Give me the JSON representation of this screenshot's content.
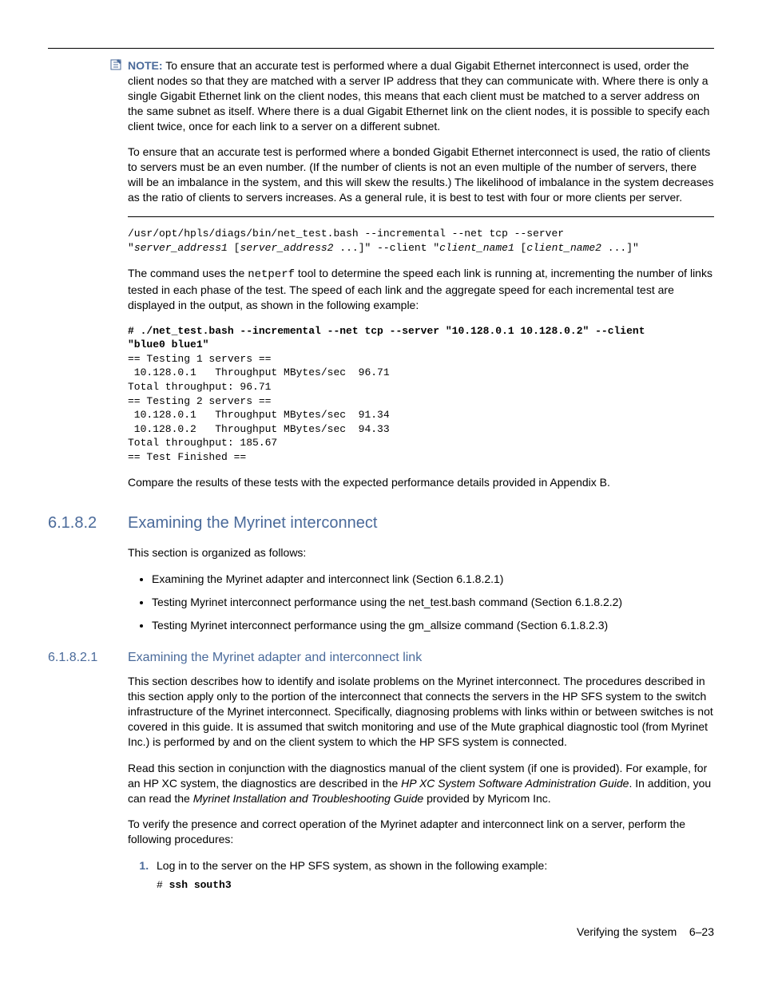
{
  "note": {
    "label": "NOTE:",
    "p1": "To ensure that an accurate test is performed where a dual Gigabit Ethernet interconnect is used, order the client nodes so that they are matched with a server IP address that they can communicate with. Where there is only a single Gigabit Ethernet link on the client nodes, this means that each client must be matched to a server address on the same subnet as itself. Where there is a dual Gigabit Ethernet link on the client nodes, it is possible to specify each client twice, once for each link to a server on a different subnet.",
    "p2": "To ensure that an accurate test is performed where a bonded Gigabit Ethernet interconnect is used, the ratio of clients to servers must be an even number. (If the number of clients is not an even multiple of the number of servers, there will be an imbalance in the system, and this will skew the results.) The likelihood of imbalance in the system decreases as the ratio of clients to servers increases. As a general rule, it is best to test with four or more clients per server."
  },
  "code1": {
    "line1a": "/usr/opt/hpls/diags/bin/net_test.bash --incremental --net tcp --server ",
    "line1b": "\"",
    "sv1": "server_address1",
    "br1": " [",
    "sv2": "server_address2",
    "el1": " ...]",
    "line2a": "\" --client \"",
    "cl1": "client_name1",
    "br2": " [",
    "cl2": "client_name2",
    "el2": " ...]",
    "end": "\""
  },
  "para_cmd_a": "The command uses the ",
  "para_cmd_tool": "netperf",
  "para_cmd_b": " tool to determine the speed each link is running at, incrementing the number of links tested in each phase of the test. The speed of each link and the aggregate speed for each incremental test are displayed in the output, as shown in the following example:",
  "code2": {
    "hdr1": "# ./net_test.bash --incremental --net tcp --server \"10.128.0.1 10.128.0.2\" --client ",
    "hdr2": "\"blue0 blue1\"",
    "body": "\n== Testing 1 servers ==\n 10.128.0.1   Throughput MBytes/sec  96.71\nTotal throughput: 96.71\n== Testing 2 servers ==\n 10.128.0.1   Throughput MBytes/sec  91.34\n 10.128.0.2   Throughput MBytes/sec  94.33\nTotal throughput: 185.67\n== Test Finished =="
  },
  "para_compare": "Compare the results of these tests with the expected performance details provided in Appendix B.",
  "s6182": {
    "num": "6.1.8.2",
    "title": "Examining the Myrinet interconnect",
    "intro": "This section is organized as follows:",
    "bullets": [
      "Examining the Myrinet adapter and interconnect link (Section 6.1.8.2.1)",
      "Testing Myrinet interconnect performance using the net_test.bash command (Section 6.1.8.2.2)",
      "Testing Myrinet interconnect performance using the gm_allsize command (Section 6.1.8.2.3)"
    ]
  },
  "s61821": {
    "num": "6.1.8.2.1",
    "title": "Examining the Myrinet adapter and interconnect link",
    "p1": "This section describes how to identify and isolate problems on the Myrinet interconnect. The procedures described in this section apply only to the portion of the interconnect that connects the servers in the HP SFS system to the switch infrastructure of the Myrinet interconnect. Specifically, diagnosing problems with links within or between switches is not covered in this guide. It is assumed that switch monitoring and use of the Mute graphical diagnostic tool (from Myrinet Inc.) is performed by and on the client system to which the HP SFS system is connected.",
    "p2a": "Read this section in conjunction with the diagnostics manual of the client system (if one is provided). For example, for an HP XC system, the diagnostics are described in the ",
    "p2i1": "HP XC System Software Administration Guide",
    "p2b": ". In addition, you can read the ",
    "p2i2": "Myrinet Installation and Troubleshooting Guide",
    "p2c": " provided by Myricom Inc.",
    "p3": "To verify the presence and correct operation of the Myrinet adapter and interconnect link on a server, perform the following procedures:",
    "step1": "Log in to the server on the HP SFS system, as shown in the following example:",
    "step1code_a": "# ",
    "step1code_b": "ssh south3"
  },
  "footer": {
    "text": "Verifying the system",
    "page": "6–23"
  }
}
